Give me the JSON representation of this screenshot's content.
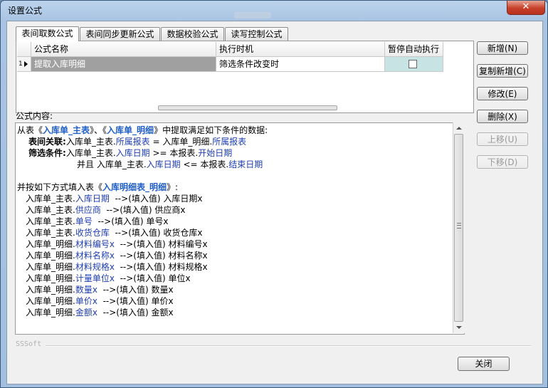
{
  "window": {
    "title": "设置公式",
    "close_glyph": "✕"
  },
  "tabs": [
    {
      "label": "表间取数公式",
      "active": true
    },
    {
      "label": "表间同步更新公式",
      "active": false
    },
    {
      "label": "数据校验公式",
      "active": false
    },
    {
      "label": "读写控制公式",
      "active": false
    }
  ],
  "grid": {
    "headers": [
      "公式名称",
      "执行时机",
      "暂停自动执行"
    ],
    "rows": [
      {
        "num": "1",
        "name": "提取入库明细",
        "timing": "筛选条件改变时",
        "paused": false
      }
    ]
  },
  "buttons": {
    "add": "新增(N)",
    "copy_add": "复制新增(C)",
    "edit": "修改(E)",
    "delete": "删除(X)",
    "move_up": "上移(U)",
    "move_down": "下移(D)",
    "close": "关闭"
  },
  "formula_label": "公式内容:",
  "formula": {
    "l1": {
      "a": "从表《",
      "b": "入库单_主表",
      "c": "》、《",
      "d": "入库单_明细",
      "e": "》中提取满足如下条件的数据:"
    },
    "l2": {
      "kw": "表间关联:",
      "a": "入库单_主表.",
      "b": "所属报表",
      "c": " = 入库单_明细.",
      "d": "所属报表"
    },
    "l3": {
      "kw": "筛选条件:",
      "a": "入库单_主表.",
      "b": "入库日期",
      "c": " >= 本报表.",
      "d": "开始日期"
    },
    "l4": {
      "a": "并且 入库单_主表.",
      "b": "入库日期",
      "c": " <= 本报表.",
      "d": "结束日期"
    },
    "l5": {
      "a": "并按如下方式填入表《",
      "b": "入库明细表_明细",
      "c": "》:"
    },
    "mappings": [
      {
        "src": "入库单_主表.",
        "field": "入库日期",
        "arrow": "  -->(填入值) ",
        "dst": "入库日期x"
      },
      {
        "src": "入库单_主表.",
        "field": "供应商",
        "arrow": "  -->(填入值) ",
        "dst": "供应商x"
      },
      {
        "src": "入库单_主表.",
        "field": "单号",
        "arrow": "  -->(填入值) ",
        "dst": "单号x"
      },
      {
        "src": "入库单_主表.",
        "field": "收货仓库",
        "arrow": "  -->(填入值) ",
        "dst": "收货仓库x"
      },
      {
        "src": "入库单_明细.",
        "field": "材料编号x",
        "arrow": "  -->(填入值) ",
        "dst": "材料编号x"
      },
      {
        "src": "入库单_明细.",
        "field": "材料名称x",
        "arrow": "  -->(填入值) ",
        "dst": "材料名称x"
      },
      {
        "src": "入库单_明细.",
        "field": "材料规格x",
        "arrow": "  -->(填入值) ",
        "dst": "材料规格x"
      },
      {
        "src": "入库单_明细.",
        "field": "计量单位x",
        "arrow": "  -->(填入值) ",
        "dst": "单位x"
      },
      {
        "src": "入库单_明细.",
        "field": "数量x",
        "arrow": "  -->(填入值) ",
        "dst": "数量x"
      },
      {
        "src": "入库单_明细.",
        "field": "单价x",
        "arrow": "  -->(填入值) ",
        "dst": "单价x"
      },
      {
        "src": "入库单_明细.",
        "field": "金额x",
        "arrow": "  -->(填入值) ",
        "dst": "金额x"
      }
    ]
  },
  "brand": "SSSoft"
}
